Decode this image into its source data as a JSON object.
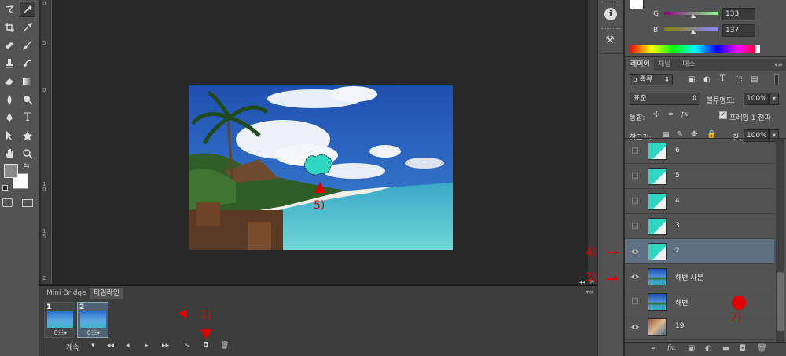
{
  "toolbox": {
    "tools": [
      "lasso-icon",
      "magic-wand-icon",
      "crop-icon",
      "eyedropper-icon",
      "spot-heal-icon",
      "brush-icon",
      "stamp-icon",
      "history-brush-icon",
      "eraser-icon",
      "gradient-icon",
      "blur-icon",
      "dodge-icon",
      "pen-icon",
      "type-icon",
      "path-select-icon",
      "shape-icon",
      "hand-icon",
      "zoom-icon"
    ]
  },
  "ruler_ticks": [
    "0",
    "5",
    "1 0",
    "1 5",
    "2"
  ],
  "canvas": {
    "annotation_5": "5)"
  },
  "timeline": {
    "tabs": [
      "Mini Bridge",
      "타임라인"
    ],
    "frames": [
      {
        "num": "1",
        "delay": "0초▾"
      },
      {
        "num": "2",
        "delay": "0초▾"
      }
    ],
    "loop": "계속",
    "annotation_1": "1)"
  },
  "color_panel": {
    "g_label": "G",
    "g_value": "133",
    "b_label": "B",
    "b_value": "137",
    "top_value": "133"
  },
  "layers_panel": {
    "tabs": [
      "레이어",
      "채널",
      "패스"
    ],
    "kind_filter": "ρ 종류",
    "blend_mode": "표준",
    "opacity_label": "불투명도:",
    "opacity_value": "100%",
    "unify_label": "통합:",
    "propagate_label": "프레임 1 전파",
    "lock_label": "잠그기:",
    "fill_label": "칠:",
    "fill_value": "100%",
    "layers": [
      {
        "name": "6",
        "visible": false,
        "selected": false
      },
      {
        "name": "5",
        "visible": false,
        "selected": false
      },
      {
        "name": "4",
        "visible": false,
        "selected": false
      },
      {
        "name": "3",
        "visible": false,
        "selected": false
      },
      {
        "name": "2",
        "visible": true,
        "selected": true
      },
      {
        "name": "해변 사본",
        "visible": true,
        "selected": false
      },
      {
        "name": "해변",
        "visible": false,
        "selected": false
      },
      {
        "name": "19",
        "visible": true,
        "selected": false
      }
    ],
    "annotation_2": "2)",
    "annotation_3": "3)",
    "annotation_4": "4)"
  },
  "colors": {
    "accent_red": "#e00000",
    "selection_blue": "#5e7082",
    "cyan_shape": "#2fd6c2"
  }
}
